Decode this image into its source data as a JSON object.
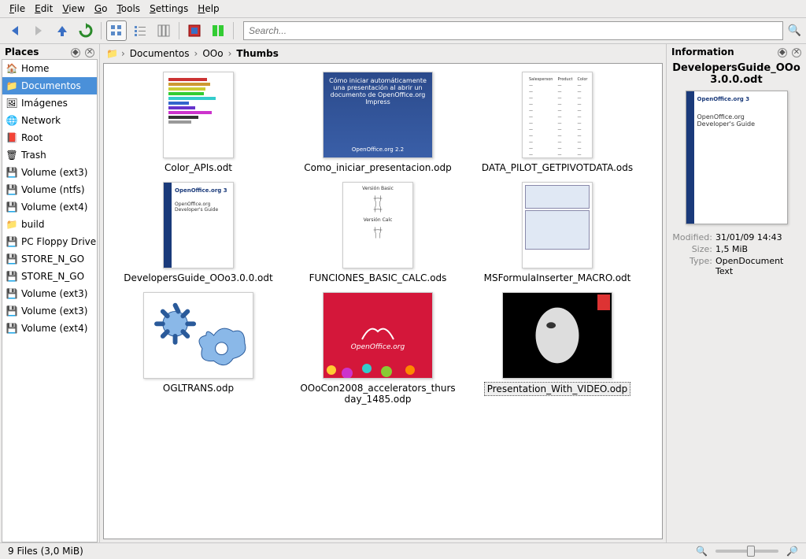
{
  "menu": [
    "File",
    "Edit",
    "View",
    "Go",
    "Tools",
    "Settings",
    "Help"
  ],
  "search": {
    "placeholder": "Search..."
  },
  "places": {
    "title": "Places",
    "items": [
      {
        "icon": "🏠",
        "label": "Home",
        "sel": false
      },
      {
        "icon": "📁",
        "label": "Documentos",
        "sel": true,
        "color": "#3a6fc4"
      },
      {
        "icon": "🖼",
        "label": "Imágenes",
        "sel": false
      },
      {
        "icon": "🌐",
        "label": "Network",
        "sel": false
      },
      {
        "icon": "📕",
        "label": "Root",
        "sel": false,
        "color": "#c33"
      },
      {
        "icon": "🗑",
        "label": "Trash",
        "sel": false
      },
      {
        "icon": "💾",
        "label": "Volume (ext3)",
        "sel": false
      },
      {
        "icon": "💾",
        "label": "Volume (ntfs)",
        "sel": false
      },
      {
        "icon": "💾",
        "label": "Volume (ext4)",
        "sel": false
      },
      {
        "icon": "📁",
        "label": "build",
        "sel": false
      },
      {
        "icon": "💾",
        "label": "PC Floppy Drive",
        "sel": false
      },
      {
        "icon": "💾",
        "label": "STORE_N_GO",
        "sel": false
      },
      {
        "icon": "💾",
        "label": "STORE_N_GO",
        "sel": false
      },
      {
        "icon": "💾",
        "label": "Volume (ext3)",
        "sel": false
      },
      {
        "icon": "💾",
        "label": "Volume (ext3)",
        "sel": false
      },
      {
        "icon": "💾",
        "label": "Volume (ext4)",
        "sel": false
      }
    ]
  },
  "breadcrumb": [
    "Documentos",
    "OOo",
    "Thumbs"
  ],
  "files": [
    {
      "name": "Color_APIs.odt",
      "kind": "color"
    },
    {
      "name": "Como_iniciar_presentacion.odp",
      "kind": "blue",
      "text": "Cómo iniciar automáticamente una presentación al abrir un documento de OpenOffice.org Impress",
      "sub": "OpenOffice.org 2.2"
    },
    {
      "name": "DATA_PILOT_GETPIVOTDATA.ods",
      "kind": "table"
    },
    {
      "name": "DevelopersGuide_OOo3.0.0.odt",
      "kind": "ooguide",
      "logo": "OpenOffice.org 3",
      "sub": "OpenOffice.org Developer's Guide"
    },
    {
      "name": "FUNCIONES_BASIC_CALC.ods",
      "kind": "func"
    },
    {
      "name": "MSFormulaInserter_MACRO.odt",
      "kind": "macro"
    },
    {
      "name": "OGLTRANS.odp",
      "kind": "shapes"
    },
    {
      "name": "OOoCon2008_accelerators_thursday_1485.odp",
      "kind": "red",
      "logo": "OpenOffice.org"
    },
    {
      "name": "Presentation_With_VIDEO.odp",
      "kind": "video",
      "sel": true
    }
  ],
  "info": {
    "title": "Information",
    "filename": "DevelopersGuide_OOo3.0.0.odt",
    "preview_logo": "OpenOffice.org 3",
    "preview_sub": "OpenOffice.org Developer's Guide",
    "meta": [
      {
        "label": "Modified:",
        "value": "31/01/09 14:43"
      },
      {
        "label": "Size:",
        "value": "1,5 MiB"
      },
      {
        "label": "Type:",
        "value": "OpenDocument Text"
      }
    ]
  },
  "status": {
    "text": "9 Files (3,0 MiB)"
  },
  "thumb_blue_sub": "OpenOffice.org 2.2",
  "thumb_table_headers": [
    "Salesperson",
    "Product",
    "Color"
  ],
  "colorbars": [
    "#c33",
    "#c93",
    "#cc3",
    "#3c3",
    "#3cc",
    "#36c",
    "#63c",
    "#c3c",
    "#333",
    "#999"
  ]
}
